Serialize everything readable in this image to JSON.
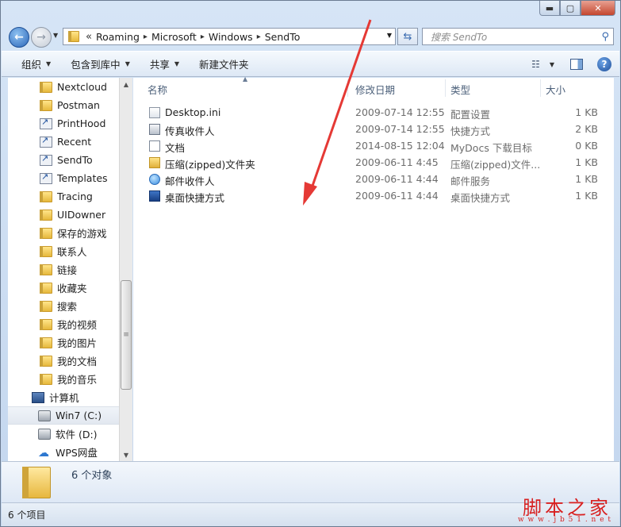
{
  "window": {
    "minimize": "▬",
    "maximize": "▢",
    "close": "✕"
  },
  "address": {
    "overflow": "«",
    "path": [
      "Roaming",
      "Microsoft",
      "Windows",
      "SendTo"
    ],
    "search_placeholder": "搜索 SendTo"
  },
  "toolbar": {
    "organize": "组织",
    "include_in_library": "包含到库中",
    "share": "共享",
    "new_folder": "新建文件夹"
  },
  "nav": {
    "items": [
      {
        "label": "Nextcloud",
        "icon": "folder-icon"
      },
      {
        "label": "Postman",
        "icon": "folder-icon"
      },
      {
        "label": "PrintHood",
        "icon": "shortcut-icon"
      },
      {
        "label": "Recent",
        "icon": "shortcut-icon"
      },
      {
        "label": "SendTo",
        "icon": "shortcut-icon"
      },
      {
        "label": "Templates",
        "icon": "shortcut-icon"
      },
      {
        "label": "Tracing",
        "icon": "folder-icon"
      },
      {
        "label": "UIDowner",
        "icon": "folder-icon"
      },
      {
        "label": "保存的游戏",
        "icon": "folder-icon"
      },
      {
        "label": "联系人",
        "icon": "folder-icon"
      },
      {
        "label": "链接",
        "icon": "folder-icon"
      },
      {
        "label": "收藏夹",
        "icon": "folder-icon"
      },
      {
        "label": "搜索",
        "icon": "folder-icon"
      },
      {
        "label": "我的视频",
        "icon": "folder-icon"
      },
      {
        "label": "我的图片",
        "icon": "folder-icon"
      },
      {
        "label": "我的文档",
        "icon": "folder-icon"
      },
      {
        "label": "我的音乐",
        "icon": "folder-icon"
      }
    ],
    "computer": "计算机",
    "drives": [
      {
        "label": "Win7 (C:)",
        "icon": "windows-drive-icon",
        "selected": true
      },
      {
        "label": "软件 (D:)",
        "icon": "drive-icon",
        "selected": false
      },
      {
        "label": "WPS网盘",
        "icon": "cloud-icon",
        "selected": false
      }
    ]
  },
  "columns": {
    "name": "名称",
    "date": "修改日期",
    "type": "类型",
    "size": "大小"
  },
  "files": [
    {
      "name": "Desktop.ini",
      "date": "2009-07-14 12:55",
      "type": "配置设置",
      "size": "1 KB",
      "icon": "ini-file-icon"
    },
    {
      "name": "传真收件人",
      "date": "2009-07-14 12:55",
      "type": "快捷方式",
      "size": "2 KB",
      "icon": "fax-icon"
    },
    {
      "name": "文档",
      "date": "2014-08-15 12:04",
      "type": "MyDocs 下载目标",
      "size": "0 KB",
      "icon": "document-icon"
    },
    {
      "name": "压缩(zipped)文件夹",
      "date": "2009-06-11 4:45",
      "type": "压缩(zipped)文件...",
      "size": "1 KB",
      "icon": "zip-folder-icon"
    },
    {
      "name": "邮件收件人",
      "date": "2009-06-11 4:44",
      "type": "邮件服务",
      "size": "1 KB",
      "icon": "mail-icon"
    },
    {
      "name": "桌面快捷方式",
      "date": "2009-06-11 4:44",
      "type": "桌面快捷方式",
      "size": "1 KB",
      "icon": "desktop-icon"
    }
  ],
  "details": {
    "summary": "6 个对象"
  },
  "status": {
    "count": "6 个项目"
  },
  "watermark": {
    "main": "脚本之家",
    "sub": "w w w . j b 5 1 . n e t"
  },
  "colors": {
    "accent_red": "#e53935",
    "selection": "#e2e8f0"
  }
}
